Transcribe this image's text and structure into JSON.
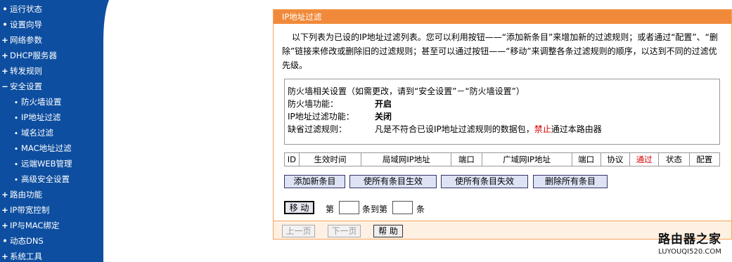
{
  "sidebar": {
    "items": [
      {
        "bullet": "•",
        "label": "运行状态"
      },
      {
        "bullet": "•",
        "label": "设置向导"
      },
      {
        "bullet": "+",
        "label": "网络参数"
      },
      {
        "bullet": "+",
        "label": "DHCP服务器"
      },
      {
        "bullet": "+",
        "label": "转发规则"
      },
      {
        "bullet": "−",
        "label": "安全设置"
      },
      {
        "bullet": "•",
        "label": "防火墙设置"
      },
      {
        "bullet": "•",
        "label": "IP地址过滤"
      },
      {
        "bullet": "•",
        "label": "域名过滤"
      },
      {
        "bullet": "•",
        "label": "MAC地址过滤"
      },
      {
        "bullet": "•",
        "label": "远端WEB管理"
      },
      {
        "bullet": "•",
        "label": "高级安全设置"
      },
      {
        "bullet": "+",
        "label": "路由功能"
      },
      {
        "bullet": "+",
        "label": "IP带宽控制"
      },
      {
        "bullet": "+",
        "label": "IP与MAC绑定"
      },
      {
        "bullet": "•",
        "label": "动态DNS"
      },
      {
        "bullet": "+",
        "label": "系统工具"
      }
    ]
  },
  "panel": {
    "title": "IP地址过滤",
    "intro": "以下列表为已设的IP地址过滤列表。您可以利用按钮——“添加新条目”来增加新的过滤规则；或者通过“配置”、“删除”链接来修改或删除旧的过滤规则；甚至可以通过按钮——“移动”来调整各条过滤规则的顺序，以达到不同的过滤优先级。"
  },
  "firewall": {
    "heading": "防火墙相关设置（如需更改，请到“安全设置”－“防火墙设置”）",
    "firewall_label": "防火墙功能：",
    "firewall_value": "开启",
    "ipfilter_label": "IP地址过滤功能：",
    "ipfilter_value": "关闭",
    "default_label": "缺省过滤规则：",
    "default_prefix": "凡是不符合已设IP地址过滤规则的数据包，",
    "default_highlight": "禁止",
    "default_suffix": "通过本路由器"
  },
  "table": {
    "headers": [
      "ID",
      "生效时间",
      "局域网IP地址",
      "端口",
      "广域网IP地址",
      "端口",
      "协议",
      "通过",
      "状态",
      "配置"
    ]
  },
  "buttons": {
    "add": "添加新条目",
    "enable_all": "使所有条目生效",
    "disable_all": "使所有条目失效",
    "delete_all": "删除所有条目",
    "move": "移 动",
    "move_label_1": "第",
    "move_label_2": "条到第",
    "move_label_3": "条",
    "prev": "上一页",
    "next": "下一页",
    "help": "帮 助"
  },
  "watermark": {
    "title": "路由器之家",
    "url": "LUYOUQI520.COM"
  },
  "colors": {
    "sidebar_bg": "#0d4ea0",
    "panel_title_bg": "#f08a3a",
    "panel_border": "#f4a460",
    "highlight_red": "#d40000"
  }
}
